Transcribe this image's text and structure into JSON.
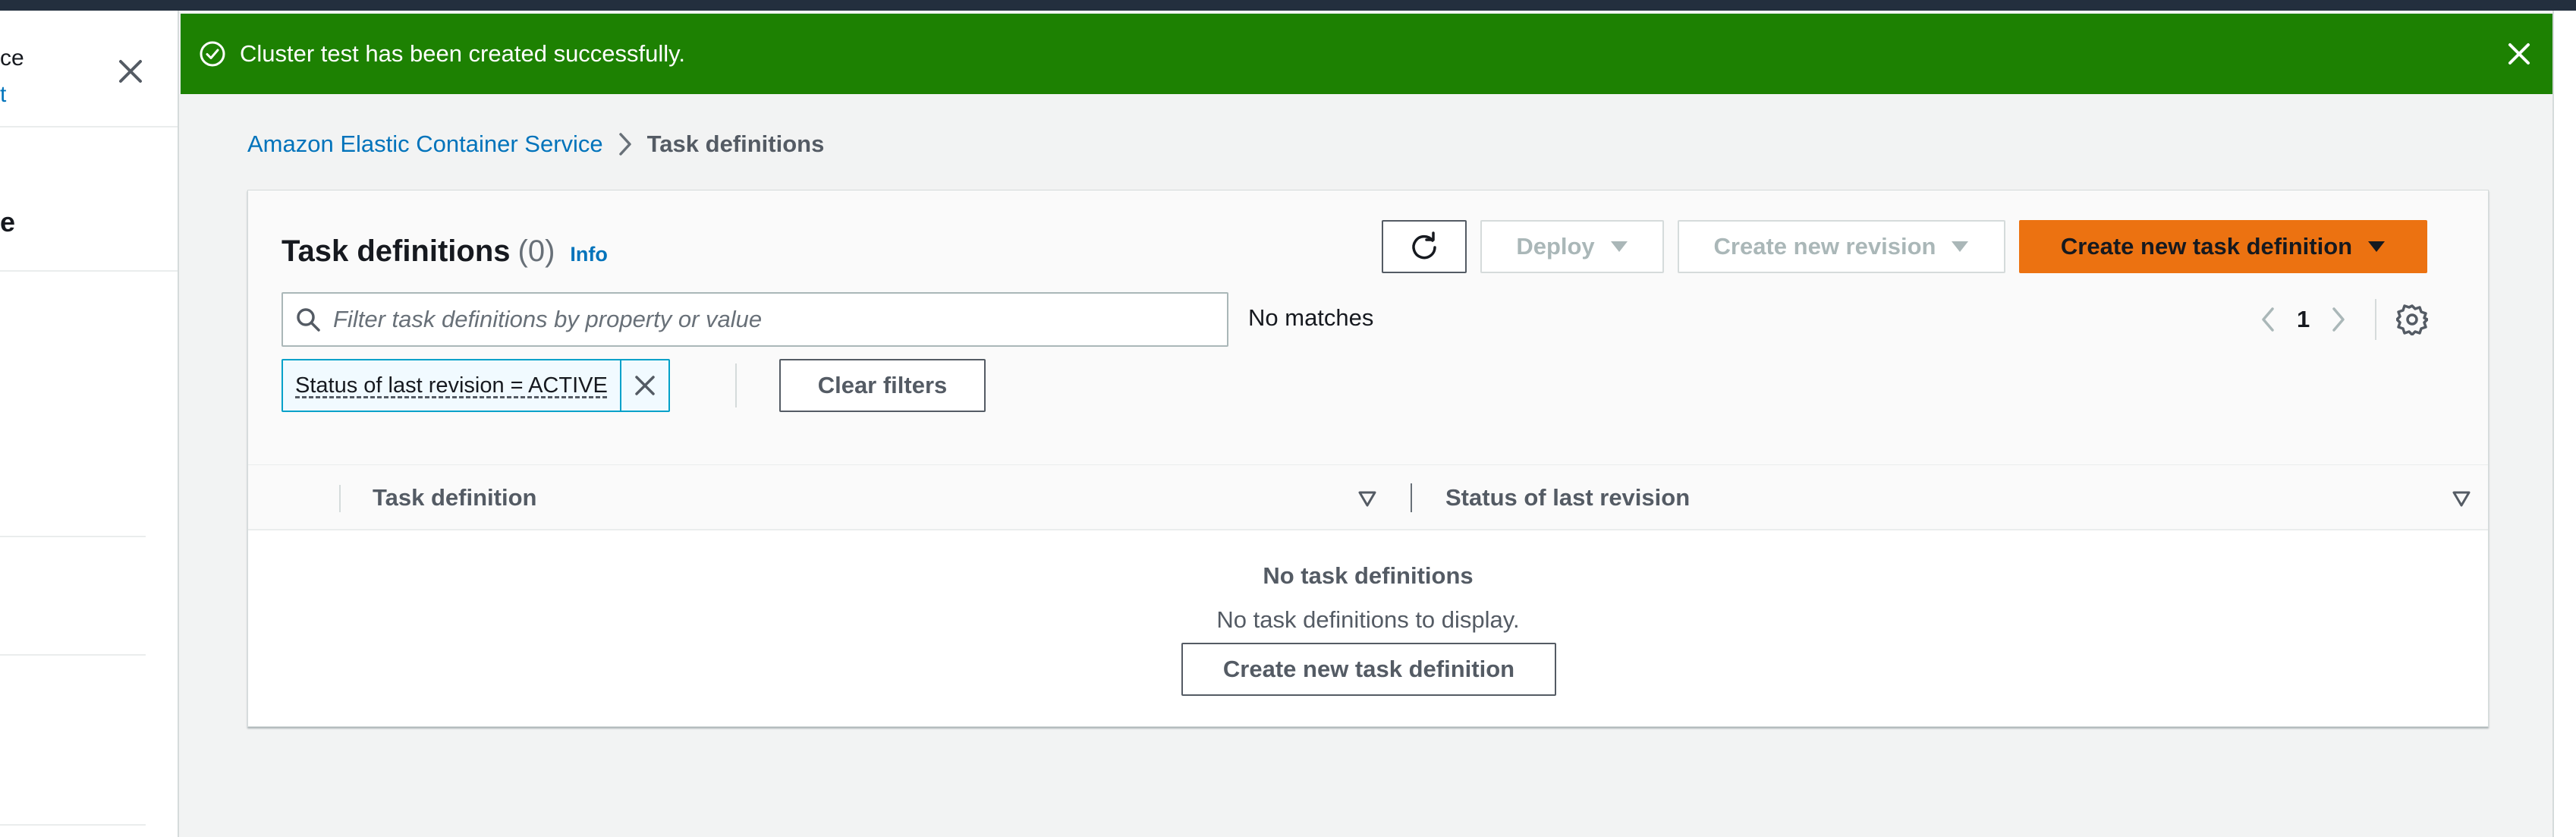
{
  "sidebar": {
    "title_fragment": "ce",
    "link_fragment": "t",
    "heading_fragment": "e"
  },
  "flash": {
    "message": "Cluster test has been created successfully.",
    "color": "#1d8102"
  },
  "breadcrumb": {
    "root": "Amazon Elastic Container Service",
    "current": "Task definitions"
  },
  "table_header": {
    "title": "Task definitions",
    "count": "(0)",
    "info": "Info"
  },
  "actions": {
    "deploy": "Deploy",
    "create_revision": "Create new revision",
    "create_task_definition": "Create new task definition",
    "primary_color": "#ec7211"
  },
  "filter": {
    "placeholder": "Filter task definitions by property or value",
    "value": "",
    "result": "No matches",
    "token": "Status of last revision = ACTIVE",
    "clear": "Clear filters"
  },
  "pagination": {
    "current_page": "1"
  },
  "columns": [
    {
      "label": "Task definition"
    },
    {
      "label": "Status of last revision"
    }
  ],
  "empty_state": {
    "title": "No task definitions",
    "subtitle": "No task definitions to display.",
    "action": "Create new task definition"
  }
}
